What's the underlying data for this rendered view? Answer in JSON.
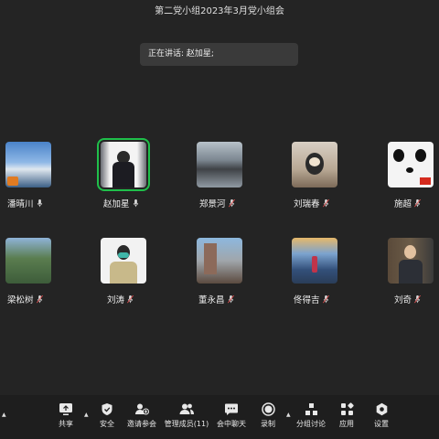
{
  "window": {
    "title": "第二党小组2023年3月党小组会"
  },
  "speaker": {
    "label": "正在讲话: 赵加星;"
  },
  "participants": [
    {
      "name": "潘晴川",
      "mic": "on"
    },
    {
      "name": "赵加星",
      "mic": "on",
      "active": true
    },
    {
      "name": "郑景河",
      "mic": "muted"
    },
    {
      "name": "刘瑞春",
      "mic": "muted"
    },
    {
      "name": "施超",
      "mic": "muted"
    },
    {
      "name": "梁松树",
      "mic": "muted"
    },
    {
      "name": "刘涛",
      "mic": "muted"
    },
    {
      "name": "董永昌",
      "mic": "muted"
    },
    {
      "name": "佟得吉",
      "mic": "muted"
    },
    {
      "name": "刘奇",
      "mic": "muted"
    }
  ],
  "toolbar": {
    "share": "共享",
    "security": "安全",
    "invite": "邀请参会",
    "manage": "管理成员(11)",
    "chat": "会中聊天",
    "record": "录制",
    "breakout": "分组讨论",
    "apps": "应用",
    "settings": "设置"
  },
  "colors": {
    "active_outline": "#1fbf4a",
    "muted_mic": "#e05050",
    "background": "#242424"
  }
}
